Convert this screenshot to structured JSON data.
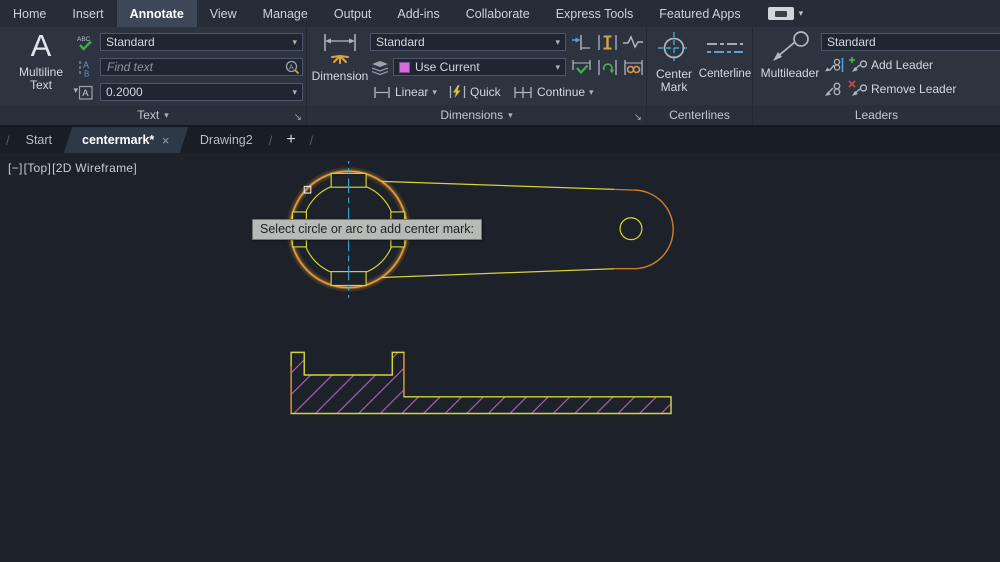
{
  "menubar": {
    "tabs": [
      "Home",
      "Insert",
      "Annotate",
      "View",
      "Manage",
      "Output",
      "Add-ins",
      "Collaborate",
      "Express Tools",
      "Featured Apps"
    ],
    "active_tab": "Annotate"
  },
  "ribbon": {
    "text_panel": {
      "footer_label": "Text",
      "big_button_label": "Multiline Text",
      "style_value": "Standard",
      "find_placeholder": "Find text",
      "height_value": "0.2000"
    },
    "dimensions_panel": {
      "footer_label": "Dimensions",
      "big_button_label": "Dimension",
      "style_value": "Standard",
      "layer_value": "Use Current",
      "linear_label": "Linear",
      "quick_label": "Quick",
      "continue_label": "Continue"
    },
    "centerlines_panel": {
      "footer_label": "Centerlines",
      "center_mark_label": "Center Mark",
      "centerline_label": "Centerline"
    },
    "leaders_panel": {
      "footer_label": "Leaders",
      "big_button_label": "Multileader",
      "style_value": "Standard",
      "add_leader_label": "Add Leader",
      "remove_leader_label": "Remove Leader"
    }
  },
  "file_tabs": {
    "start_label": "Start",
    "active_label": "centermark*",
    "drawing2_label": "Drawing2",
    "new_tab_glyph": "+",
    "close_glyph": "×",
    "separator_glyph": "/"
  },
  "canvas": {
    "viewport_minus": "[−]",
    "viewport_view": "[Top]",
    "viewport_visual_style": "[2D Wireframe]",
    "tooltip_text": "Select circle or arc to add center mark:"
  },
  "icon_glyphs": {
    "chevron_down": "▾",
    "launcher_arrow": "↘",
    "mtext_a": "A",
    "spell_abc": "ABC",
    "style_a": "A",
    "style_b": "B",
    "boxed_a": "A",
    "search_a": "A"
  },
  "colors": {
    "entity_yellow": "#d4d438",
    "highlight_orange": "#e09a38",
    "arc_orange": "#cd7b2b",
    "hatch_magenta": "#c973cb",
    "centerline_cyan": "#38a5d5",
    "layer_swatch_magenta": "#d36ee0",
    "tooltip_bg": "#b7bab7"
  }
}
